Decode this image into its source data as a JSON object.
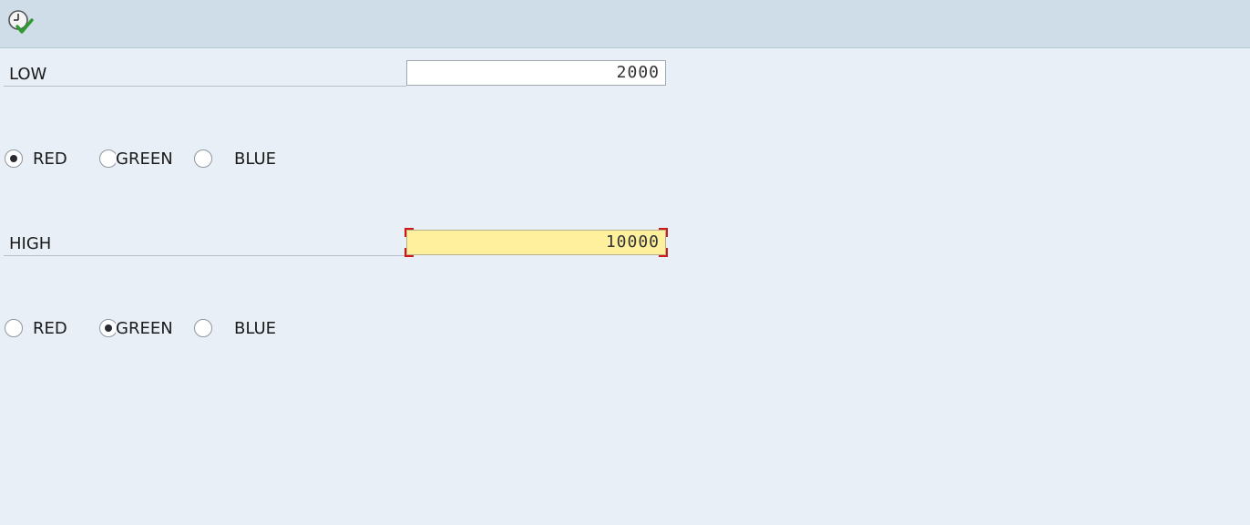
{
  "toolbar": {
    "execute_icon": "execute-clock-check-icon"
  },
  "low": {
    "label": "LOW",
    "value": "2000",
    "radios": [
      {
        "label": "RED",
        "selected": true
      },
      {
        "label": "GREEN",
        "selected": false
      },
      {
        "label": "BLUE",
        "selected": false
      }
    ]
  },
  "high": {
    "label": "HIGH",
    "value": "10000",
    "radios": [
      {
        "label": "RED",
        "selected": false
      },
      {
        "label": "GREEN",
        "selected": true
      },
      {
        "label": "BLUE",
        "selected": false
      }
    ]
  },
  "colors": {
    "background": "#e8eff7",
    "toolbar": "#cfdde8",
    "focused_field": "#fff09e",
    "focus_corners": "#cc1a1a"
  }
}
